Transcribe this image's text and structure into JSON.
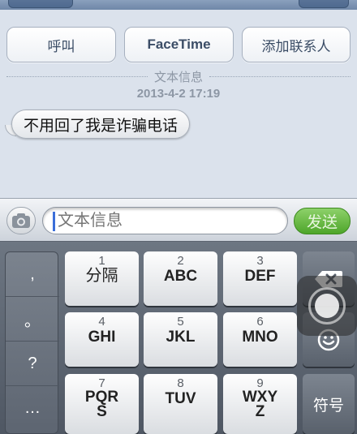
{
  "actions": {
    "call_label": "呼叫",
    "facetime_label": "FaceTime",
    "add_contact_label": "添加联系人"
  },
  "thread": {
    "section_label": "文本信息",
    "timestamp": "2013-4-2 17:19",
    "messages": [
      {
        "from": "them",
        "text": "不用回了我是诈骗电话"
      }
    ]
  },
  "composer": {
    "placeholder": "文本信息",
    "send_label": "发送"
  },
  "keyboard": {
    "punctuation": [
      ",",
      "。",
      "?",
      "…"
    ],
    "keys": [
      {
        "num": "1",
        "letters": "分隔"
      },
      {
        "num": "2",
        "letters": "ABC"
      },
      {
        "num": "3",
        "letters": "DEF"
      },
      {
        "num": "4",
        "letters": "GHI"
      },
      {
        "num": "5",
        "letters": "JKL"
      },
      {
        "num": "6",
        "letters": "MNO"
      },
      {
        "num": "7",
        "letters": "PQR\nS"
      },
      {
        "num": "8",
        "letters": "TUV"
      },
      {
        "num": "9",
        "letters": "WXY\nZ"
      }
    ],
    "symbols_label": "符号"
  },
  "colors": {
    "send_green": "#4ea62a",
    "caret_blue": "#3b6fd9",
    "background": "#dbe2ec"
  }
}
